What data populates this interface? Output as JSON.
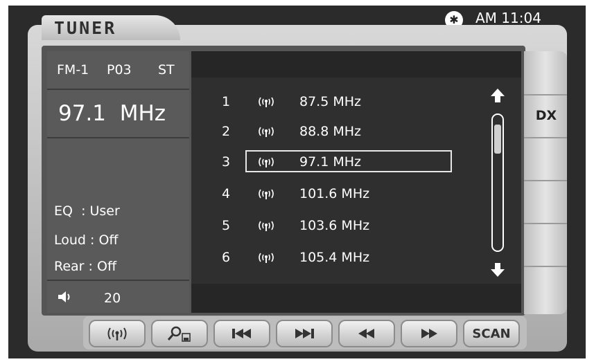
{
  "status_bar": {
    "bluetooth_icon": "bluetooth-icon",
    "time": "AM 11:04"
  },
  "title": "TUNER",
  "left_panel": {
    "band": "FM-1",
    "preset": "P03",
    "stereo": "ST",
    "frequency": "97.1  MHz",
    "settings": [
      {
        "label": "EQ",
        "value": ": User"
      },
      {
        "label": "Loud",
        "value": ": Off"
      },
      {
        "label": "Rear",
        "value": ": Off"
      }
    ],
    "volume_icon": "speaker-icon",
    "volume": "20"
  },
  "stations": [
    {
      "num": "1",
      "freq": "87.5 MHz"
    },
    {
      "num": "2",
      "freq": "88.8 MHz"
    },
    {
      "num": "3",
      "freq": "97.1 MHz",
      "selected": true
    },
    {
      "num": "4",
      "freq": "101.6 MHz"
    },
    {
      "num": "5",
      "freq": "103.6 MHz"
    },
    {
      "num": "6",
      "freq": "105.4 MHz"
    }
  ],
  "station_icon": "antenna-icon",
  "side_buttons": {
    "dx": "DX"
  },
  "controls": [
    {
      "name": "band-button",
      "icon": "antenna-icon"
    },
    {
      "name": "search-save-button",
      "icon": "search-save-icon"
    },
    {
      "name": "previous-track-button",
      "icon": "skip-back-icon"
    },
    {
      "name": "next-track-button",
      "icon": "skip-forward-icon"
    },
    {
      "name": "seek-back-button",
      "icon": "rewind-icon"
    },
    {
      "name": "seek-forward-button",
      "icon": "fast-forward-icon"
    },
    {
      "name": "scan-button",
      "label": "SCAN"
    }
  ]
}
